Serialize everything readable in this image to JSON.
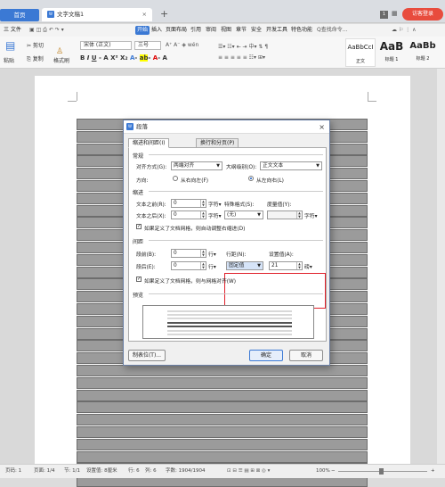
{
  "tabs": {
    "home": "首页",
    "doc": "文字文稿1",
    "new": "+"
  },
  "window": {
    "badge": "1",
    "login": "访客登录"
  },
  "menu": {
    "file": "三 文件",
    "items": [
      "开始",
      "插入",
      "页面布局",
      "引用",
      "审阅",
      "视图",
      "章节",
      "安全",
      "开发工具",
      "特色功能"
    ],
    "search": "Q查找命令..."
  },
  "ribbon": {
    "paste": "粘贴",
    "cut": "剪切",
    "copy": "复制",
    "format_painter": "格式刷",
    "font": "宋体 (正文)",
    "size": "三号",
    "styles": [
      {
        "sample": "AaBbCcI",
        "name": "正文"
      },
      {
        "sample": "AaB",
        "name": "标题 1"
      },
      {
        "sample": "AaBb",
        "name": "标题 2"
      }
    ]
  },
  "dialog": {
    "title": "段落",
    "close": "×",
    "tabs": [
      "缩进和间距(I)",
      "换行和分页(P)"
    ],
    "general": {
      "section": "常规",
      "align_label": "对齐方式(G):",
      "align_value": "两端对齐",
      "outline_label": "大纲级别(O):",
      "outline_value": "正文文本",
      "direction_label": "方向:",
      "rtl": "从右向左(F)",
      "ltr": "从左向右(L)"
    },
    "indent": {
      "section": "缩进",
      "before_label": "文本之前(R):",
      "before_value": "0",
      "before_unit": "字符",
      "special_label": "特殊格式(S):",
      "special_value": "(无)",
      "measure_label": "度量值(Y):",
      "measure_unit": "字符",
      "after_label": "文本之后(X):",
      "after_value": "0",
      "after_unit": "字符",
      "grid_check": "如果定义了文档网格，则自动调整右缩进(D)"
    },
    "spacing": {
      "section": "间距",
      "before_label": "段前(B):",
      "before_value": "0",
      "before_unit": "行",
      "after_label": "段后(E):",
      "after_value": "0",
      "after_unit": "行",
      "line_label": "行距(N):",
      "line_value": "固定值",
      "setting_label": "设置值(A):",
      "setting_value": "21",
      "setting_unit": "磅",
      "grid_check": "如果定义了文档网格，则与网格对齐(W)"
    },
    "preview": {
      "section": "预览"
    },
    "buttons": {
      "tabs": "制表位(T)...",
      "ok": "确定",
      "cancel": "取消"
    }
  },
  "status": {
    "page": "页码: 1",
    "pages": "页面: 1/4",
    "section": "节: 1/1",
    "setting": "设置值: 8厘米",
    "row": "行: 6",
    "col": "列: 6",
    "words": "字数: 1904/1904",
    "zoom": "100%"
  }
}
